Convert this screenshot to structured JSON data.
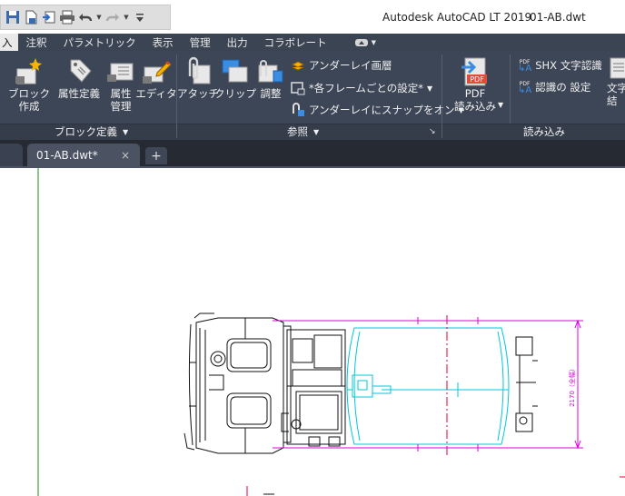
{
  "window": {
    "app_title": "Autodesk AutoCAD LT 2019",
    "doc_title": "01-AB.dwt"
  },
  "quick_access": {
    "icons": [
      "save-icon",
      "save-as-icon",
      "export-icon",
      "print-icon",
      "undo-icon",
      "redo-icon",
      "customize-icon"
    ]
  },
  "ribbon_tabs": [
    {
      "label": "入",
      "active": true
    },
    {
      "label": "注釈"
    },
    {
      "label": "パラメトリック"
    },
    {
      "label": "表示"
    },
    {
      "label": "管理"
    },
    {
      "label": "出力"
    },
    {
      "label": "コラボレート"
    }
  ],
  "block_panel": {
    "create_label_1": "ブロック",
    "create_label_2": "作成",
    "attdef_label": "属性定義",
    "attmanage_label_1": "属性",
    "attmanage_label_2": "管理",
    "editor_label": "エディタ",
    "footer": "ブロック定義"
  },
  "reference_panel": {
    "attach_label": "アタッチ",
    "clip_label": "クリップ",
    "adjust_label": "調整",
    "underlay_layers": "アンダーレイ画層",
    "frames_setting": "*各フレームごとの設定*",
    "snap_underlay": "アンダーレイにスナップをオン",
    "footer": "参照"
  },
  "import_panel": {
    "pdf_icon_text": "PDF",
    "pdf_import_label_1": "PDF",
    "pdf_import_label_2": "読み込み",
    "shx_label": "SHX 文字認識",
    "recog_settings": "認識の 設定",
    "pdf_tag": "PDF",
    "text_label_1": "文字",
    "text_label_2": "結",
    "footer": "読み込み"
  },
  "file_tabs": {
    "active": "01-AB.dwt*",
    "close": "×",
    "add": "+"
  },
  "drawing": {
    "dimension_text": "2170（全幅）",
    "colors": {
      "truck": "#111111",
      "tank": "#00c8d8",
      "dimension": "#e000e0",
      "centerline": "#e0003a",
      "ucs_y_axis": "#1c8a1c"
    }
  }
}
